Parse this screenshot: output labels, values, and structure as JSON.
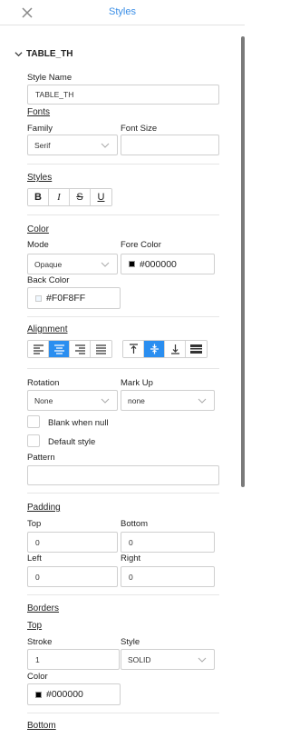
{
  "header": {
    "title": "Styles",
    "close_icon": "close-icon"
  },
  "section": {
    "name": "TABLE_TH"
  },
  "style_name": {
    "label": "Style Name",
    "value": "TABLE_TH"
  },
  "fonts": {
    "title": "Fonts",
    "family_label": "Family",
    "family_value": "Serif",
    "size_label": "Font Size",
    "size_value": ""
  },
  "styles": {
    "title": "Styles",
    "buttons": [
      "B",
      "I",
      "S",
      "U"
    ]
  },
  "color": {
    "title": "Color",
    "mode_label": "Mode",
    "mode_value": "Opaque",
    "fore_label": "Fore Color",
    "fore_value": "#000000",
    "fore_hex": "#000000",
    "back_label": "Back Color",
    "back_value": "#F0F8FF",
    "back_hex": "#F0F8FF"
  },
  "alignment": {
    "title": "Alignment",
    "horizontal": [
      "align-left",
      "align-center",
      "align-right",
      "align-justify"
    ],
    "horizontal_active": "align-center",
    "vertical": [
      "align-top",
      "align-middle",
      "align-bottom",
      "align-stretch"
    ],
    "vertical_active": "align-middle"
  },
  "rotation": {
    "label": "Rotation",
    "value": "None"
  },
  "markup": {
    "label": "Mark Up",
    "value": "none"
  },
  "blank_when_null": {
    "label": "Blank when null",
    "checked": false
  },
  "default_style": {
    "label": "Default style",
    "checked": false
  },
  "pattern": {
    "label": "Pattern",
    "value": ""
  },
  "padding": {
    "title": "Padding",
    "top_label": "Top",
    "top_value": "0",
    "bottom_label": "Bottom",
    "bottom_value": "0",
    "left_label": "Left",
    "left_value": "0",
    "right_label": "Right",
    "right_value": "0"
  },
  "borders": {
    "title": "Borders",
    "top_title": "Top",
    "stroke_label": "Stroke",
    "stroke_value": "1",
    "style_label": "Style",
    "style_value": "SOLID",
    "color_label": "Color",
    "color_value": "#000000",
    "color_hex": "#000000",
    "bottom_title": "Bottom"
  },
  "colors": {
    "accent": "#2a8ef0",
    "title": "#3a8ee6"
  }
}
